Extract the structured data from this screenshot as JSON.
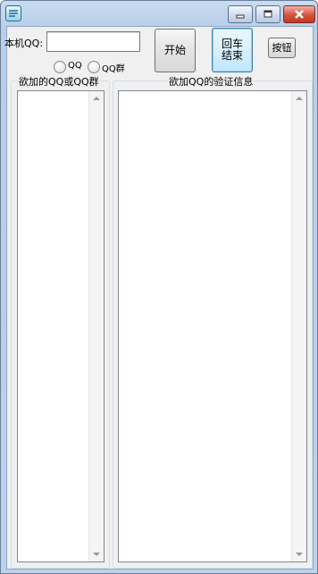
{
  "window": {
    "title": ""
  },
  "form": {
    "local_qq_label": "本机QQ:",
    "local_qq_value": "",
    "start_button": "开始",
    "enter_end_button": "回车\n结束",
    "generic_button": "按钮",
    "radio_qq": "QQ",
    "radio_qq_group": "QQ群",
    "left_group_title": "欲加的QQ或QQ群",
    "right_group_title": "欲加QQ的验证信息"
  },
  "colors": {
    "titlebar": "#c9dcf0",
    "client": "#f0f0f0",
    "close_button": "#d6503a"
  },
  "icons": {
    "app": "app-icon",
    "minimize": "minimize-icon",
    "maximize": "maximize-icon",
    "close": "close-icon"
  }
}
